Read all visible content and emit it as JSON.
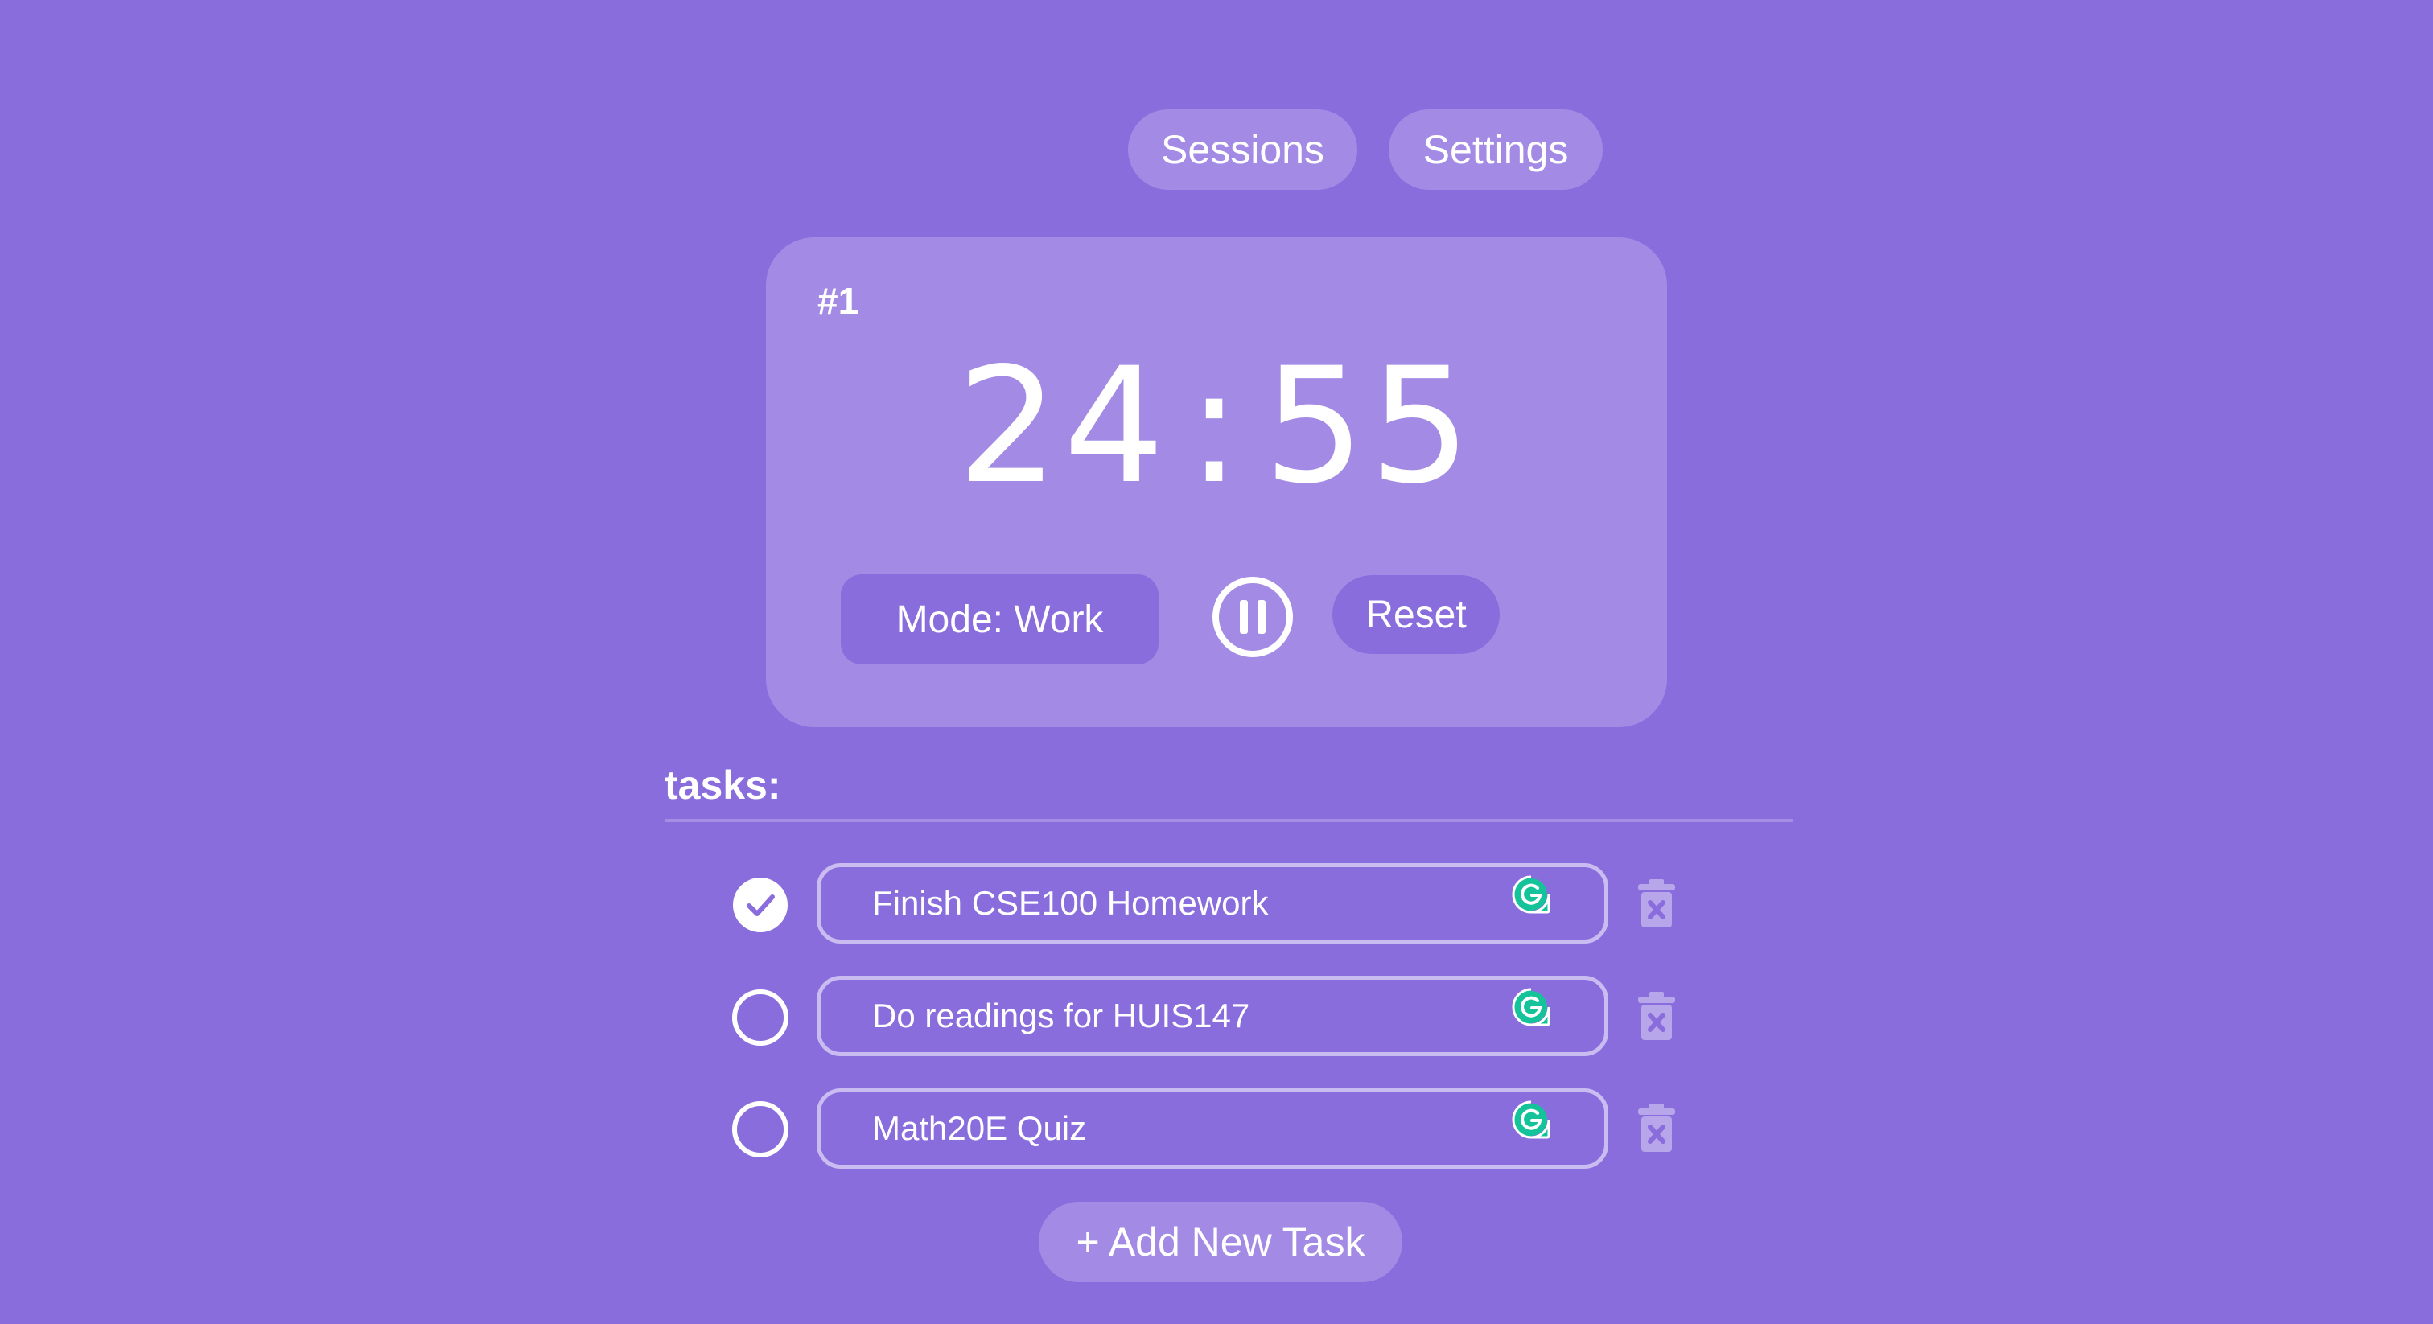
{
  "nav": {
    "sessions_label": "Sessions",
    "settings_label": "Settings"
  },
  "timer": {
    "session_number": "#1",
    "minutes": "24",
    "separator": ":",
    "seconds": "55",
    "mode_label": "Mode: Work",
    "pause_icon": "pause-circle-icon",
    "reset_label": "Reset"
  },
  "tasks": {
    "title": "tasks:",
    "items": [
      {
        "text": "Finish CSE100 Homework",
        "completed": true
      },
      {
        "text": "Do readings for HUIS147",
        "completed": false
      },
      {
        "text": "Math20E Quiz",
        "completed": false
      }
    ],
    "add_label": "+ Add New Task"
  },
  "icons": {
    "check": "check-circle-icon",
    "unchecked": "circle-icon",
    "grammarly": "grammarly-icon",
    "trash": "trash-icon"
  },
  "colors": {
    "background": "#8a6ddd",
    "card": "#a38be5",
    "text": "#ffffff",
    "grammarly_green": "#15c39a"
  }
}
